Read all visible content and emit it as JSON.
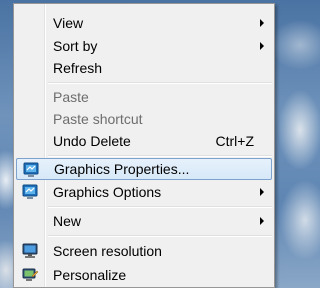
{
  "context_menu": {
    "items": [
      {
        "label": "View",
        "submenu": true
      },
      {
        "label": "Sort by",
        "submenu": true
      },
      {
        "label": "Refresh"
      },
      {
        "label": "Paste",
        "disabled": true
      },
      {
        "label": "Paste shortcut",
        "disabled": true
      },
      {
        "label": "Undo Delete",
        "shortcut": "Ctrl+Z"
      },
      {
        "label": "Graphics Properties...",
        "icon": "graphics-properties-icon",
        "highlighted": true
      },
      {
        "label": "Graphics Options",
        "icon": "graphics-options-icon",
        "submenu": true
      },
      {
        "label": "New",
        "submenu": true
      },
      {
        "label": "Screen resolution",
        "icon": "screen-resolution-icon"
      },
      {
        "label": "Personalize",
        "icon": "personalize-icon"
      }
    ]
  }
}
